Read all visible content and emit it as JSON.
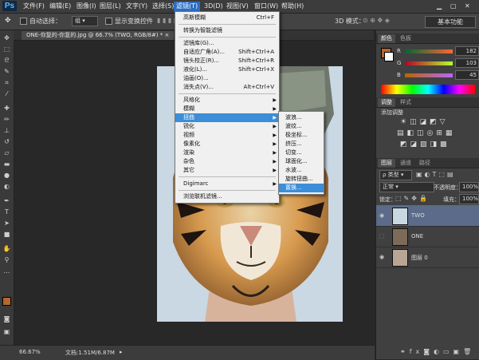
{
  "menubar": {
    "logo": "Ps",
    "items": [
      "文件(F)",
      "编辑(E)",
      "图像(I)",
      "图层(L)",
      "文字(Y)",
      "选择(S)",
      "滤镜(T)",
      "3D(D)",
      "视图(V)",
      "窗口(W)",
      "帮助(H)"
    ]
  },
  "options": {
    "auto_select_label": "自动选择：",
    "auto_select_value": "组",
    "show_transform_label": "显示变换控件",
    "mode_3d_label": "3D 模式：",
    "workspace": "基本功能"
  },
  "document": {
    "tab_title": "ONE-你复的-你复的.jpg @ 66.7% (TWO, RGB/8#) *"
  },
  "status": {
    "zoom": "66.67%",
    "doc_info": "文档:1.51M/6.87M"
  },
  "filter_menu": {
    "items": [
      {
        "label": "高斯模糊",
        "shortcut": "Ctrl+F"
      },
      {
        "label": "转换为智能滤镜"
      },
      {
        "label": "滤镜库(G)..."
      },
      {
        "label": "自适应广角(A)...",
        "shortcut": "Shift+Ctrl+A"
      },
      {
        "label": "镜头校正(R)...",
        "shortcut": "Shift+Ctrl+R"
      },
      {
        "label": "液化(L)...",
        "shortcut": "Shift+Ctrl+X"
      },
      {
        "label": "油画(O)..."
      },
      {
        "label": "消失点(V)...",
        "shortcut": "Alt+Ctrl+V"
      },
      {
        "label": "风格化"
      },
      {
        "label": "模糊"
      },
      {
        "label": "扭曲"
      },
      {
        "label": "锐化"
      },
      {
        "label": "视频"
      },
      {
        "label": "像素化"
      },
      {
        "label": "渲染"
      },
      {
        "label": "杂色"
      },
      {
        "label": "其它"
      },
      {
        "label": "Digimarc"
      },
      {
        "label": "浏览联机滤镜..."
      }
    ]
  },
  "distort_submenu": {
    "items": [
      "波浪...",
      "波纹...",
      "极坐标...",
      "挤压...",
      "切变...",
      "球面化...",
      "水波...",
      "旋转扭曲...",
      "置换..."
    ]
  },
  "color_panel": {
    "tabs": [
      "颜色",
      "色板"
    ],
    "r_label": "R",
    "g_label": "G",
    "b_label": "B",
    "r": "182",
    "g": "103",
    "b": "45",
    "foreground": "#b6672d"
  },
  "adjust_panel": {
    "tabs": [
      "调整",
      "样式"
    ],
    "title": "添加调整"
  },
  "layers_panel": {
    "tabs": [
      "图层",
      "通道",
      "路径"
    ],
    "kind_label": "类型",
    "blend_mode": "正常",
    "opacity_label": "不透明度：",
    "opacity": "100%",
    "lock_label": "锁定：",
    "fill_label": "填充：",
    "fill": "100%",
    "layers": [
      "TWO",
      "ONE",
      "图层 0"
    ]
  }
}
